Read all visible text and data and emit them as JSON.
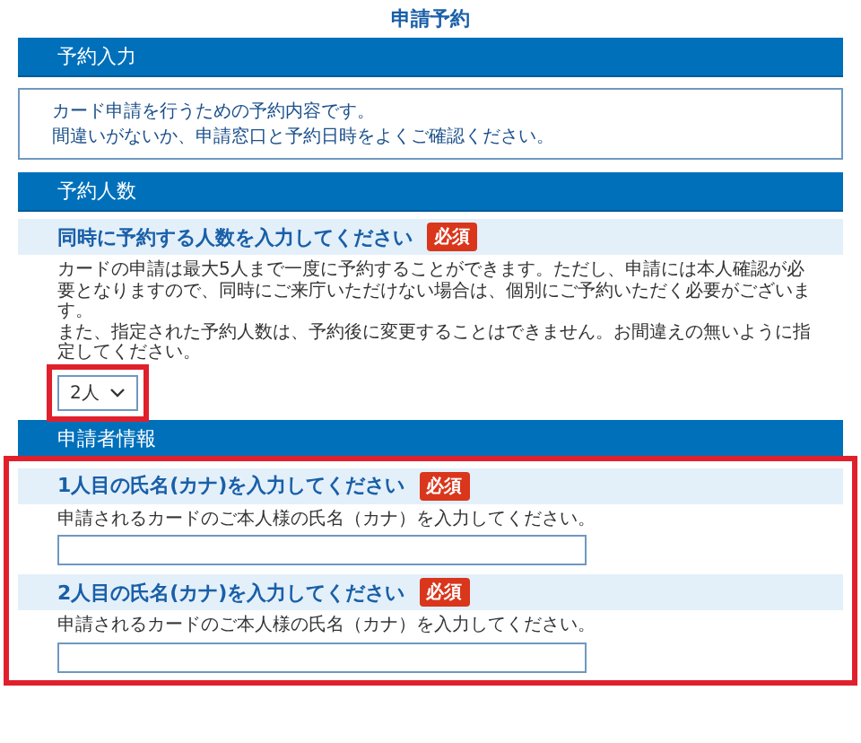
{
  "title": "申請予約",
  "sections": [
    {
      "heading": "予約入力",
      "blocks": [
        {
          "kind": "notice",
          "lines": [
            "カード申請を行うための予約内容です。",
            "間違いがないか、申請窓口と予約日時をよくご確認ください。"
          ]
        }
      ]
    },
    {
      "heading": "予約人数",
      "blocks": [
        {
          "kind": "question",
          "label": "同時に予約する人数を入力してください",
          "badge": "必須",
          "description": [
            "カードの申請は最大5人まで一度に予約することができます。ただし、申請には本人確認が必要となりますので、同時にご来庁いただけない場合は、個別にご予約いただく必要がございます。",
            "また、指定された予約人数は、予約後に変更することはできません。お間違えの無いように指定してください。"
          ],
          "control": {
            "kind": "select",
            "value": "2人",
            "highlighted": true
          }
        }
      ]
    },
    {
      "heading": "申請者情報",
      "highlighted": true,
      "blocks": [
        {
          "kind": "question",
          "label": "1人目の氏名(カナ)を入力してください",
          "badge": "必須",
          "description": [
            "申請されるカードのご本人様の氏名（カナ）を入力してください。"
          ],
          "control": {
            "kind": "text"
          }
        },
        {
          "kind": "question",
          "label": "2人目の氏名(カナ)を入力してください",
          "badge": "必須",
          "description": [
            "申請されるカードのご本人様の氏名（カナ）を入力してください。"
          ],
          "control": {
            "kind": "text"
          }
        }
      ]
    }
  ]
}
